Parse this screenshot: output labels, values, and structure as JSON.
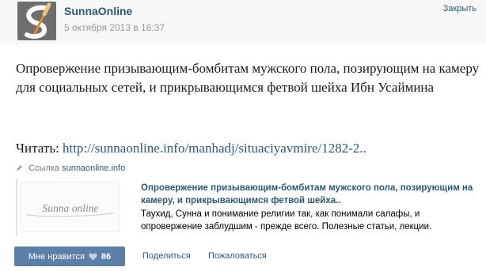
{
  "header": {
    "author": "SunnaOnline",
    "date": "5 октября 2013 в 16:37",
    "close_label": "Закрыть",
    "avatar_icon": "sunna-online-quill-logo-icon"
  },
  "post": {
    "title": "Опровержение призывающим-бомбитам мужского пола, позирующим на камеру для социальных сетей, и прикрывающимся фетвой шейха Ибн Усаймина",
    "read_label": "Читать:",
    "read_link": "http://sunnaonline.info/manhadj/situaciyavmire/1282-2.."
  },
  "link_preview": {
    "source_prefix": "Ссылка",
    "source_site": "sunnaonline.info",
    "thumbnail_text": "Sunna online",
    "title": "Опровержение призывающим-бомбитам мужского пола, позирующим на камеру, и прикрывающимся фетвой шейха..",
    "description": "Таухид, Сунна и понимание религии так, как понимали салафы, и опровержение заблудшим - прежде всего. Полезные статьи, лекции."
  },
  "actions": {
    "like_label": "Мне нравится",
    "like_count": "86",
    "share_label": "Поделиться",
    "report_label": "Пожаловаться"
  },
  "colors": {
    "link": "#2b587a",
    "like_button": "#5b7fa6",
    "header_bg": "#f7f7f7"
  }
}
